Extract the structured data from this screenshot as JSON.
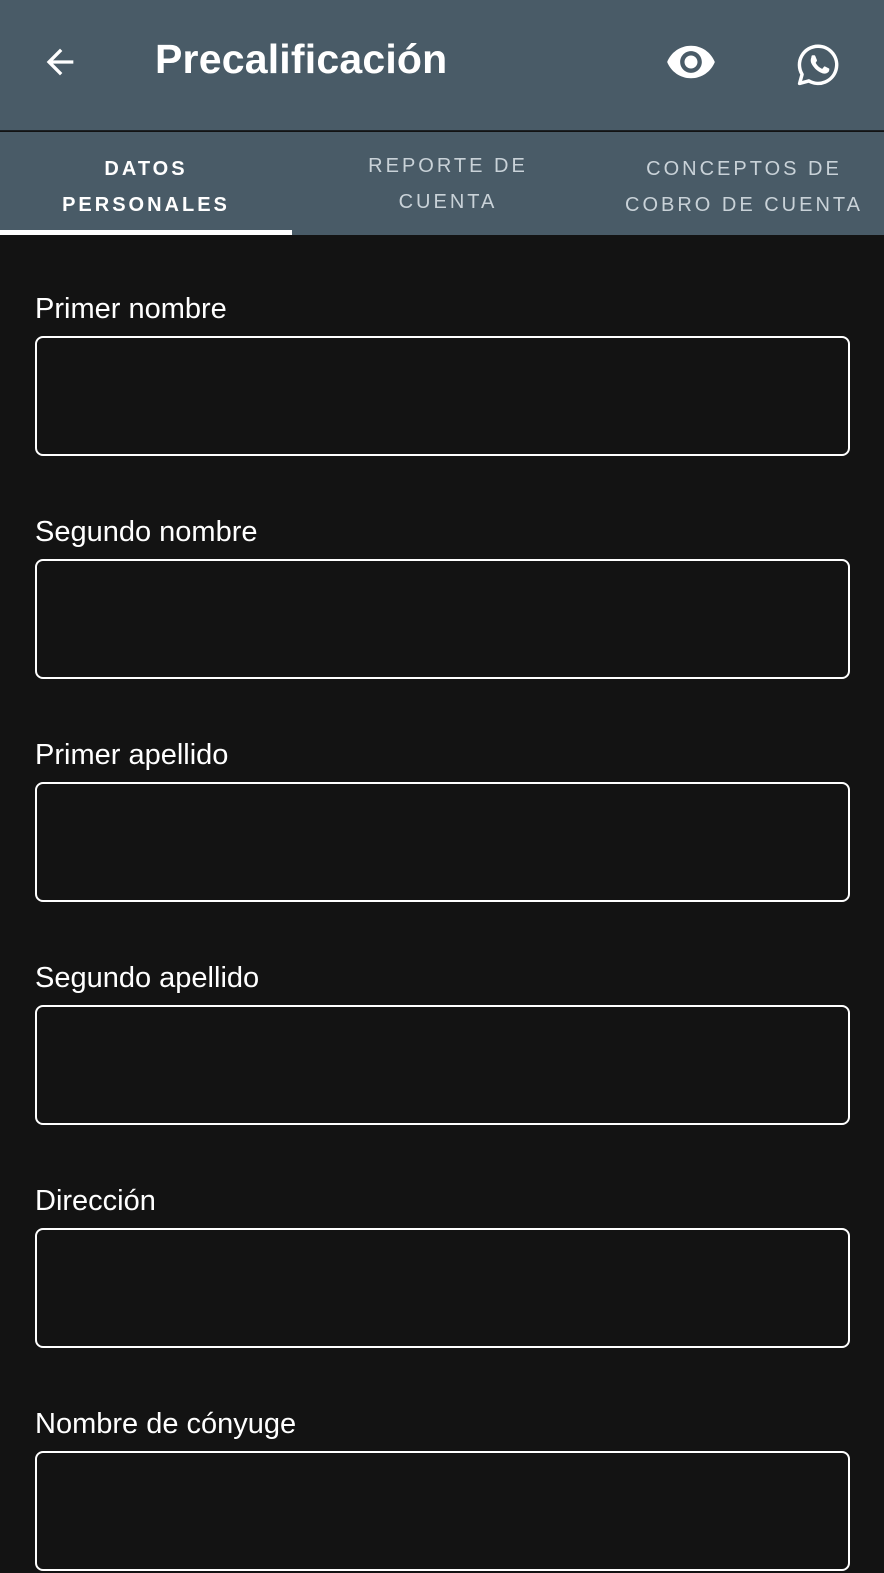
{
  "appbar": {
    "title": "Precalificación",
    "back_icon": "arrow-left-icon",
    "eye_icon": "eye-icon",
    "whatsapp_icon": "whatsapp-icon"
  },
  "tabs": [
    {
      "line1": "DATOS",
      "line2": "PERSONALES",
      "active": true
    },
    {
      "line1": "REPORTE DE",
      "line2": "CUENTA",
      "active": false
    },
    {
      "line1": "CONCEPTOS DE",
      "line2": "COBRO DE CUENTA",
      "active": false
    }
  ],
  "form": {
    "fields": [
      {
        "label": "Primer nombre",
        "value": ""
      },
      {
        "label": "Segundo nombre",
        "value": ""
      },
      {
        "label": "Primer apellido",
        "value": ""
      },
      {
        "label": "Segundo apellido",
        "value": ""
      },
      {
        "label": "Dirección",
        "value": ""
      },
      {
        "label": "Nombre de cónyuge",
        "value": ""
      }
    ]
  },
  "colors": {
    "appbar": "#495b67",
    "background": "#131313",
    "text": "#ffffff"
  }
}
